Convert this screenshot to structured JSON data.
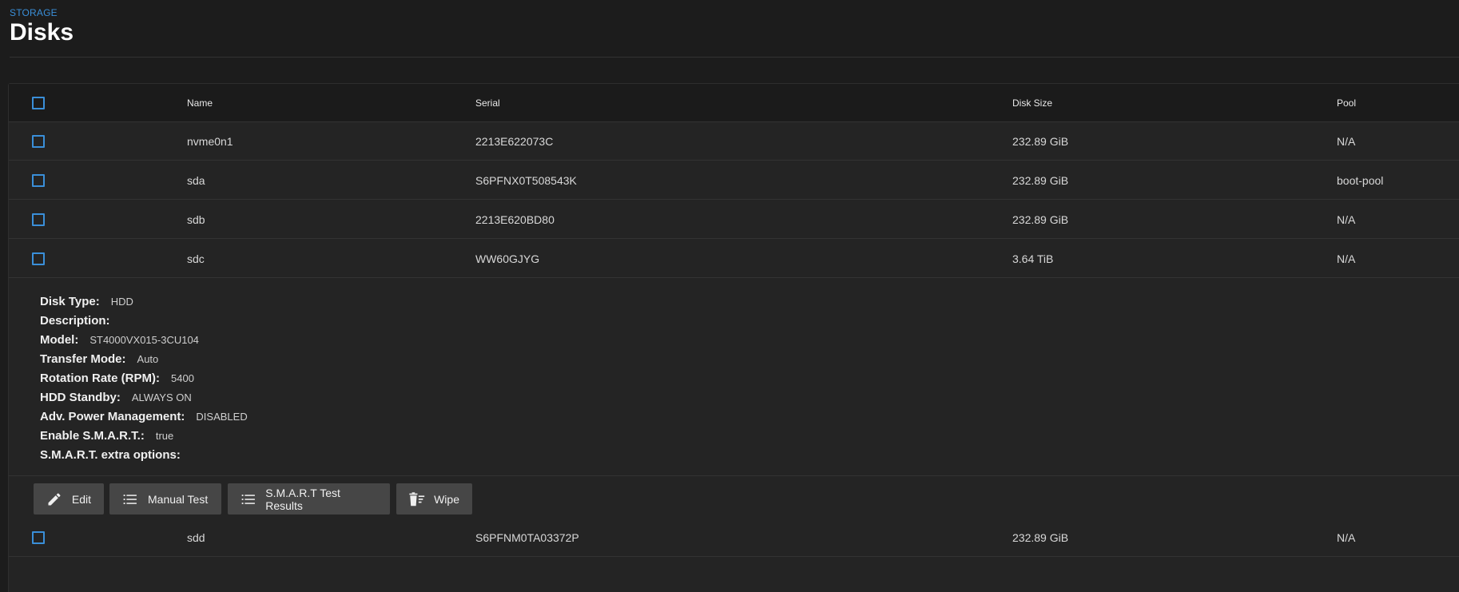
{
  "header": {
    "breadcrumb": "STORAGE",
    "title": "Disks"
  },
  "table": {
    "columns": [
      "Name",
      "Serial",
      "Disk Size",
      "Pool"
    ],
    "rows": [
      {
        "name": "nvme0n1",
        "serial": "2213E622073C",
        "size": "232.89 GiB",
        "pool": "N/A"
      },
      {
        "name": "sda",
        "serial": "S6PFNX0T508543K",
        "size": "232.89 GiB",
        "pool": "boot-pool"
      },
      {
        "name": "sdb",
        "serial": "2213E620BD80",
        "size": "232.89 GiB",
        "pool": "N/A"
      },
      {
        "name": "sdc",
        "serial": "WW60GJYG",
        "size": "3.64 TiB",
        "pool": "N/A"
      },
      {
        "name": "sdd",
        "serial": "S6PFNM0TA03372P",
        "size": "232.89 GiB",
        "pool": "N/A"
      }
    ]
  },
  "details": {
    "disk_type_label": "Disk Type:",
    "disk_type": "HDD",
    "description_label": "Description:",
    "description": "",
    "model_label": "Model:",
    "model": "ST4000VX015-3CU104",
    "transfer_mode_label": "Transfer Mode:",
    "transfer_mode": "Auto",
    "rotation_label": "Rotation Rate (RPM):",
    "rotation": "5400",
    "standby_label": "HDD Standby:",
    "standby": "ALWAYS ON",
    "apm_label": "Adv. Power Management:",
    "apm": "DISABLED",
    "smart_label": "Enable S.M.A.R.T.:",
    "smart": "true",
    "smart_options_label": "S.M.A.R.T. extra options:",
    "smart_options": ""
  },
  "actions": {
    "edit": "Edit",
    "manual_test": "Manual Test",
    "smart_results": "S.M.A.R.T Test Results",
    "wipe": "Wipe"
  },
  "colors": {
    "accent": "#3a8fd9",
    "background": "#1c1c1c",
    "card": "#242424",
    "button": "#464646"
  },
  "icons": {
    "edit": "pencil-icon",
    "manual_test": "list-icon",
    "smart_results": "list-icon",
    "wipe": "trash-list-icon"
  }
}
